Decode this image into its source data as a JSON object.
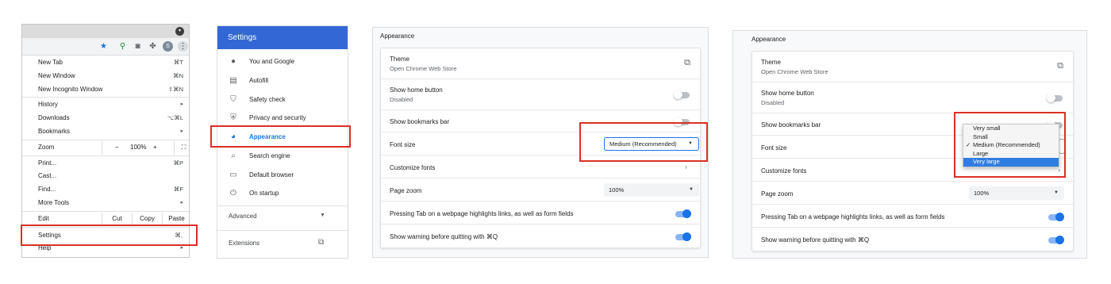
{
  "menu_panel": {
    "toolbar_icons": [
      "star-icon",
      "extension-pin-icon",
      "camera-icon",
      "puzzle-icon",
      "avatar-icon",
      "kebab-menu-icon"
    ],
    "avatar_letter": "S",
    "titlebar_dropdown_glyph": "▾",
    "groups": [
      [
        {
          "label": "New Tab",
          "shortcut": "⌘T"
        },
        {
          "label": "New Window",
          "shortcut": "⌘N"
        },
        {
          "label": "New Incognito Window",
          "shortcut": "⇧⌘N"
        }
      ],
      [
        {
          "label": "History",
          "arrow": "▸"
        },
        {
          "label": "Downloads",
          "shortcut": "⌥⌘L"
        },
        {
          "label": "Bookmarks",
          "arrow": "▸"
        }
      ]
    ],
    "zoom": {
      "label": "Zoom",
      "minus": "–",
      "value": "100%",
      "plus": "+",
      "fullscreen": "⛶"
    },
    "tools": [
      {
        "label": "Print...",
        "shortcut": "⌘P"
      },
      {
        "label": "Cast..."
      },
      {
        "label": "Find...",
        "shortcut": "⌘F"
      },
      {
        "label": "More Tools",
        "arrow": "▸"
      }
    ],
    "edit": {
      "label": "Edit",
      "cut": "Cut",
      "copy": "Copy",
      "paste": "Paste"
    },
    "settings": {
      "label": "Settings",
      "shortcut": "⌘,"
    },
    "help": {
      "label": "Help",
      "arrow": "▸"
    }
  },
  "settings_sidebar": {
    "header": "Settings",
    "items": [
      {
        "label": "You and Google",
        "icon": "person-icon"
      },
      {
        "label": "Autofill",
        "icon": "clipboard-icon"
      },
      {
        "label": "Safety check",
        "icon": "shield-check-icon"
      },
      {
        "label": "Privacy and security",
        "icon": "shield-icon"
      },
      {
        "label": "Appearance",
        "icon": "palette-icon",
        "active": true
      },
      {
        "label": "Search engine",
        "icon": "search-icon"
      },
      {
        "label": "Default browser",
        "icon": "browser-icon"
      },
      {
        "label": "On startup",
        "icon": "power-icon"
      }
    ],
    "advanced": "Advanced",
    "extensions": "Extensions"
  },
  "appearance_a": {
    "title": "Appearance",
    "theme": {
      "label": "Theme",
      "sublabel": "Open Chrome Web Store"
    },
    "home_button": {
      "label": "Show home button",
      "sublabel": "Disabled",
      "on": false
    },
    "bookmarks_bar": {
      "label": "Show bookmarks bar",
      "on": false
    },
    "font_size": {
      "label": "Font size",
      "value": "Medium (Recommended)"
    },
    "customize_fonts": {
      "label": "Customize fonts"
    },
    "page_zoom": {
      "label": "Page zoom",
      "value": "100%"
    },
    "tab_highlight": {
      "label": "Pressing Tab on a webpage highlights links, as well as form fields",
      "on": true
    },
    "quit_warning": {
      "label": "Show warning before quitting with ⌘Q",
      "on": true
    }
  },
  "appearance_b": {
    "title": "Appearance",
    "theme": {
      "label": "Theme",
      "sublabel": "Open Chrome Web Store"
    },
    "home_button": {
      "label": "Show home button",
      "sublabel": "Disabled",
      "on": false
    },
    "bookmarks_bar": {
      "label": "Show bookmarks bar",
      "on": false
    },
    "font_size": {
      "label": "Font size"
    },
    "font_size_options": [
      {
        "label": "Very small"
      },
      {
        "label": "Small"
      },
      {
        "label": "Medium (Recommended)",
        "checked": true
      },
      {
        "label": "Large"
      },
      {
        "label": "Very large",
        "highlighted": true
      }
    ],
    "check_glyph": "✓",
    "customize_fonts": {
      "label": "Customize fonts"
    },
    "page_zoom": {
      "label": "Page zoom",
      "value": "100%"
    },
    "tab_highlight": {
      "label": "Pressing Tab on a webpage highlights links, as well as form fields",
      "on": true
    },
    "quit_warning": {
      "label": "Show warning before quitting with ⌘Q",
      "on": true
    }
  },
  "colors": {
    "accent_blue": "#1a73e8",
    "header_blue": "#3367d6",
    "highlight_red": "#d93025",
    "dropdown_highlight": "#2f7de1"
  }
}
